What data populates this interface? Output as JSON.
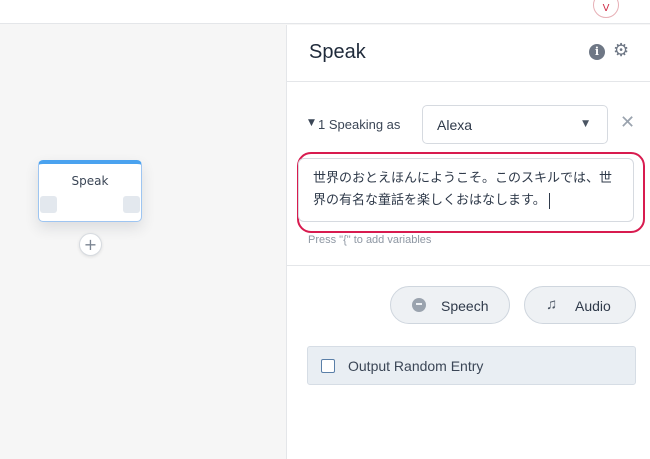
{
  "topbar": {
    "logo_letter": "V"
  },
  "canvas": {
    "node": {
      "title": "Speak"
    },
    "add_button": "+"
  },
  "panel": {
    "title": "Speak",
    "info_icon": "i",
    "gear_icon": "⚙",
    "speaking": {
      "caret": "▼",
      "label": "1 Speaking as",
      "voice": "Alexa",
      "chevron": "▼",
      "close": "✕"
    },
    "speech_text": "世界のおとえほんにようこそ。このスキルでは、世界の有名な童話を楽しくおはなします。",
    "hint": "Press \"{\" to add variables",
    "buttons": {
      "speech_label": "Speech",
      "audio_label": "Audio",
      "audio_icon": "♫"
    },
    "random": {
      "label": "Output Random Entry"
    }
  },
  "colors": {
    "accent_blue": "#4aa2ef",
    "highlight_red": "#d81b4f",
    "panel_bg": "#ffffff",
    "canvas_bg": "#f6f6f6"
  }
}
